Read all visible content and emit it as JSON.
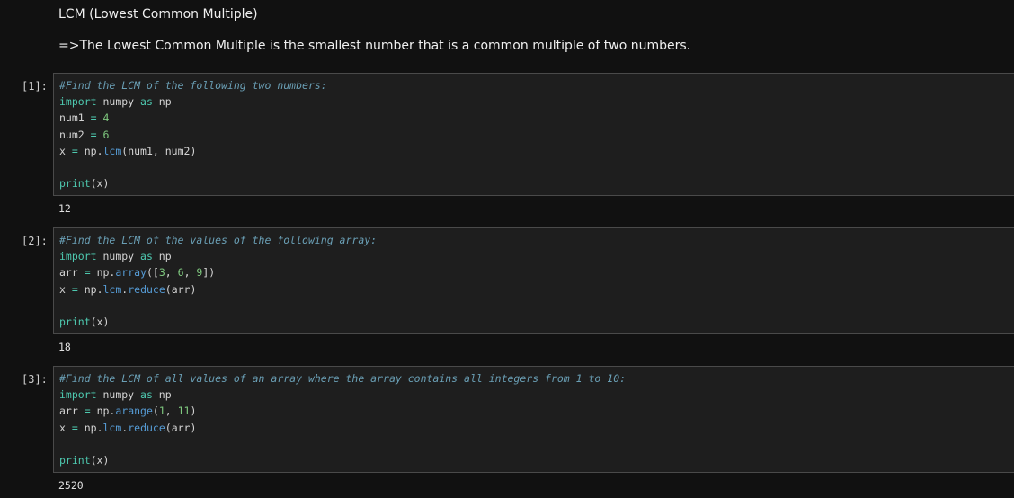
{
  "markdown": {
    "heading": "LCM (Lowest Common Multiple)",
    "description": "=>The Lowest Common Multiple is the smallest number that is a common multiple of two numbers."
  },
  "cells": [
    {
      "prompt": "[1]:",
      "comment": "#Find the LCM of the following two numbers:",
      "lines": [
        {
          "kw1": "import",
          "t1": " numpy ",
          "kw2": "as",
          "t2": " np"
        },
        {
          "t1": "num1 ",
          "op": "=",
          "num": " 4"
        },
        {
          "t1": "num2 ",
          "op": "=",
          "num": " 6"
        },
        {
          "t1": "x ",
          "op": "=",
          "t2": " np.",
          "fn": "lcm",
          "t3": "(num1, num2)"
        }
      ],
      "print_fn": "print",
      "print_arg": "(x)",
      "output": "12"
    },
    {
      "prompt": "[2]:",
      "comment": "#Find the LCM of the values of the following array:",
      "lines": [
        {
          "kw1": "import",
          "t1": " numpy ",
          "kw2": "as",
          "t2": " np"
        },
        {
          "t1": "arr ",
          "op": "=",
          "t2": " np.",
          "fn": "array",
          "t3": "([",
          "n1": "3",
          "c1": ", ",
          "n2": "6",
          "c2": ", ",
          "n3": "9",
          "t4": "])"
        },
        {
          "t1": "x ",
          "op": "=",
          "t2": " np.",
          "fn": "lcm",
          "dot": ".",
          "fn2": "reduce",
          "t3": "(arr)"
        }
      ],
      "print_fn": "print",
      "print_arg": "(x)",
      "output": "18"
    },
    {
      "prompt": "[3]:",
      "comment": "#Find the LCM of all values of an array where the array contains all integers from 1 to 10:",
      "lines": [
        {
          "kw1": "import",
          "t1": " numpy ",
          "kw2": "as",
          "t2": " np"
        },
        {
          "t1": "arr ",
          "op": "=",
          "t2": " np.",
          "fn": "arange",
          "t3": "(",
          "n1": "1",
          "c1": ", ",
          "n2": "11",
          "t4": ")"
        },
        {
          "t1": "x ",
          "op": "=",
          "t2": " np.",
          "fn": "lcm",
          "dot": ".",
          "fn2": "reduce",
          "t3": "(arr)"
        }
      ],
      "print_fn": "print",
      "print_arg": "(x)",
      "output": "2520"
    }
  ]
}
